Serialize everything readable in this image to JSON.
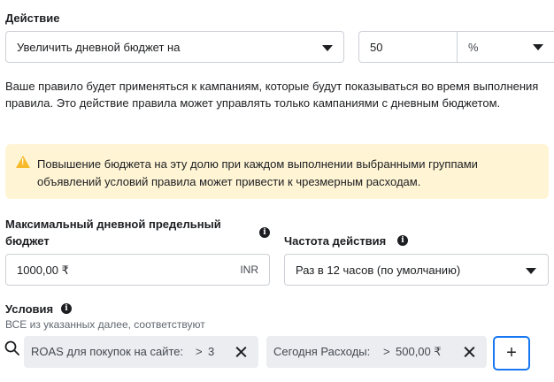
{
  "action": {
    "title": "Действие",
    "select_value": "Увеличить дневной бюджет на",
    "amount_value": "50",
    "unit_value": "%",
    "description": "Ваше правило будет применяться к кампаниям, которые будут показываться во время выполнения правила. Это действие правила может управлять только кампаниями с дневным бюджетом."
  },
  "warning": {
    "text": "Повышение бюджета на эту долю при каждом выполнении выбранными группами объявлений условий правила может привести к чрезмерным расходам."
  },
  "max_budget": {
    "label": "Максимальный дневной предельный бюджет",
    "value": "1000,00 ₹",
    "currency": "INR"
  },
  "frequency": {
    "label": "Частота действия",
    "select_value": "Раз в 12 часов (по умолчанию)"
  },
  "conditions": {
    "title": "Условия",
    "subtitle": "ВСЕ из указанных далее, соответствуют",
    "chips": [
      {
        "metric": "ROAS для покупок на сайте:",
        "operator": ">",
        "value": "3"
      },
      {
        "metric": "Сегодня Расходы:",
        "operator": ">",
        "value": "500,00 ₹"
      }
    ],
    "add_label": "+"
  },
  "colors": {
    "warning_bg": "#fff4d4",
    "warning_icon": "#f7b928",
    "chip_bg": "#ebedf0",
    "focus": "#1877f2"
  }
}
